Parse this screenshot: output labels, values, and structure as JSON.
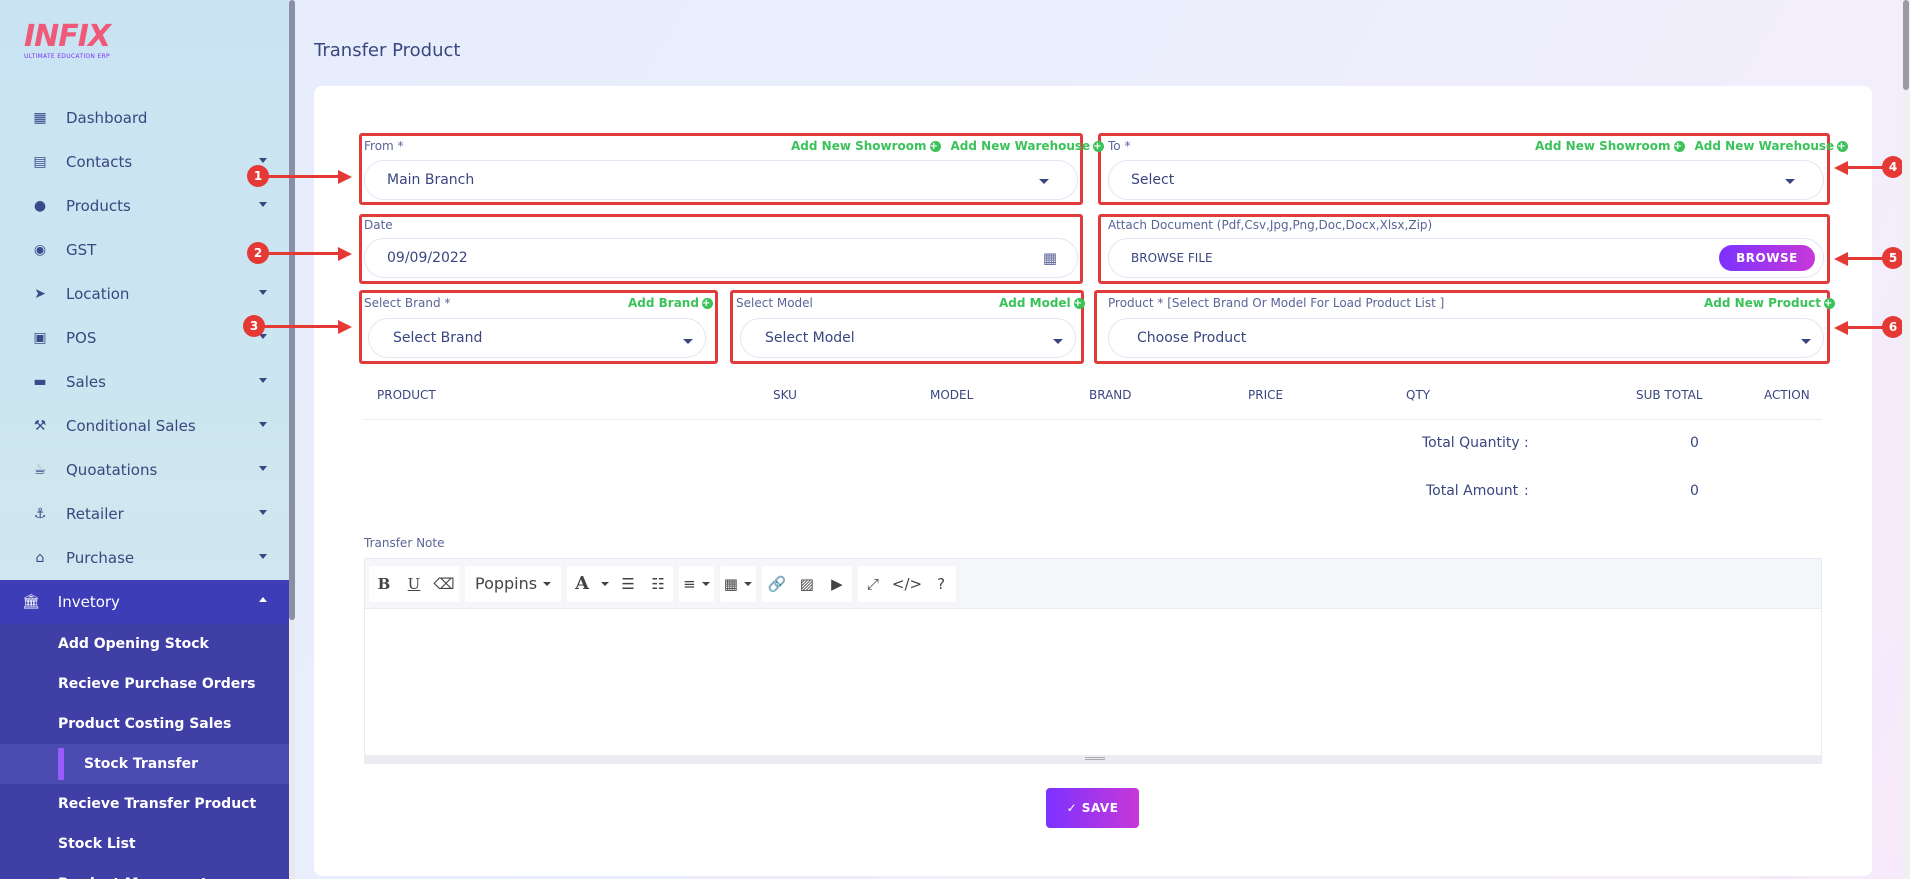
{
  "app": {
    "logo_word": "INFIX",
    "logo_tagline": "ULTIMATE EDUCATION ERP"
  },
  "sidebar": {
    "items": [
      {
        "label": "Dashboard",
        "icon": "grid-icon"
      },
      {
        "label": "Contacts",
        "icon": "contact-card-icon"
      },
      {
        "label": "Products",
        "icon": "product-circle-icon"
      },
      {
        "label": "GST",
        "icon": "gst-icon"
      },
      {
        "label": "Location",
        "icon": "location-arrow-icon"
      },
      {
        "label": "POS",
        "icon": "pos-icon"
      },
      {
        "label": "Sales",
        "icon": "sales-icon"
      },
      {
        "label": "Conditional Sales",
        "icon": "gavel-icon"
      },
      {
        "label": "Quoatations",
        "icon": "coffee-icon"
      },
      {
        "label": "Retailer",
        "icon": "retailer-icon"
      },
      {
        "label": "Purchase",
        "icon": "store-icon"
      }
    ],
    "active": {
      "label": "Invetory",
      "icon": "bank-icon"
    },
    "submenu": [
      "Add Opening Stock",
      "Recieve Purchase Orders",
      "Product Costing Sales",
      "Stock Transfer",
      "Recieve Transfer Product",
      "Stock List",
      "Product Movement"
    ]
  },
  "page": {
    "title": "Transfer Product"
  },
  "form": {
    "from": {
      "label": "From *",
      "value": "Main Branch",
      "link1": "Add New Showroom",
      "link2": "Add New Warehouse"
    },
    "to": {
      "label": "To *",
      "value": "Select",
      "link1": "Add New Showroom",
      "link2": "Add New Warehouse"
    },
    "date": {
      "label": "Date",
      "value": "09/09/2022"
    },
    "attach": {
      "label": "Attach Document (Pdf,Csv,Jpg,Png,Doc,Docx,Xlsx,Zip)",
      "value": "BROWSE FILE",
      "button": "BROWSE"
    },
    "brand": {
      "label": "Select Brand *",
      "value": "Select Brand",
      "link": "Add Brand"
    },
    "model": {
      "label": "Select Model",
      "value": "Select Model",
      "link": "Add Model"
    },
    "product": {
      "label": "Product * [Select Brand Or Model For Load Product List ]",
      "value": "Choose Product",
      "link": "Add New Product"
    }
  },
  "markers": [
    "1",
    "2",
    "3",
    "4",
    "5",
    "6"
  ],
  "table": {
    "headers": [
      "PRODUCT",
      "SKU",
      "MODEL",
      "BRAND",
      "PRICE",
      "QTY",
      "SUB TOTAL",
      "ACTION"
    ]
  },
  "totals": {
    "quantity_label": "Total Quantity",
    "quantity_value": "0",
    "amount_label": "Total Amount",
    "amount_value": "0",
    "separator": ":"
  },
  "note": {
    "label": "Transfer Note",
    "font": "Poppins"
  },
  "actions": {
    "save": "✓ SAVE"
  },
  "colors": {
    "accent": "#7c32ff",
    "link_green": "#3bc25a",
    "highlight_red": "#e13c3c",
    "sidebar_active": "#3d3db8"
  }
}
